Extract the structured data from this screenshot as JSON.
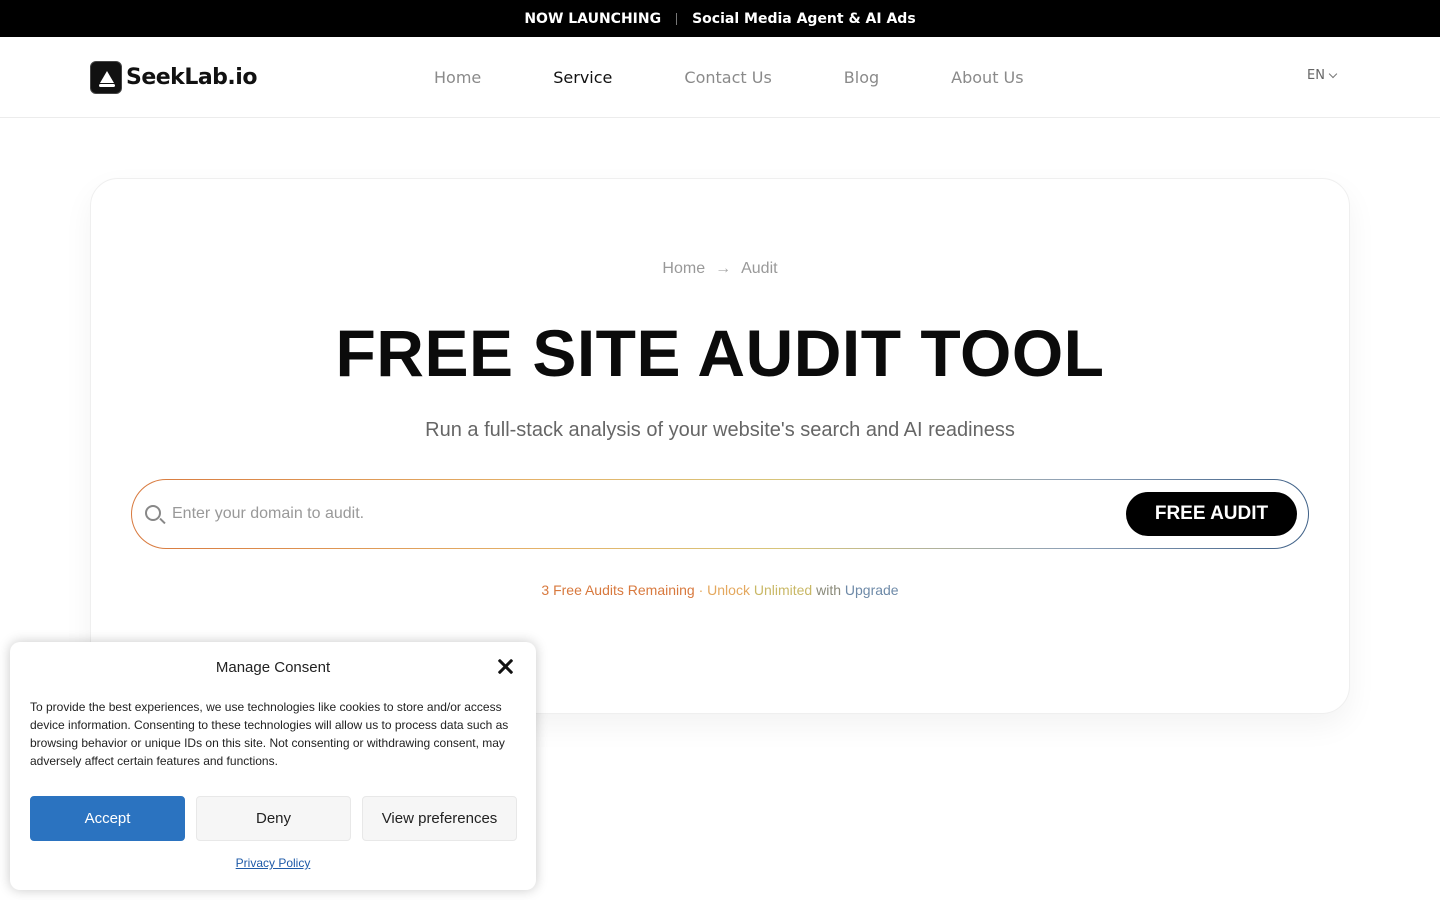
{
  "announcement": {
    "label": "NOW LAUNCHING",
    "message": "Social Media Agent & AI Ads"
  },
  "header": {
    "logo_text": "SeekLab.io",
    "nav": [
      {
        "label": "Home"
      },
      {
        "label": "Service"
      },
      {
        "label": "Contact Us"
      },
      {
        "label": "Blog"
      },
      {
        "label": "About Us"
      }
    ],
    "active_nav": "Service",
    "language": "EN"
  },
  "hero": {
    "breadcrumb": {
      "home": "Home",
      "arrow": "→",
      "current": "Audit"
    },
    "title": "FREE SITE AUDIT TOOL",
    "subtitle": "Run a full-stack analysis of your website's search and AI readiness",
    "search_placeholder": "Enter your domain to audit.",
    "search_value": "",
    "button_label": "FREE AUDIT",
    "remaining": {
      "part1": "3 Free Audits Remaining",
      "dot": " · ",
      "part2": "Unlock ",
      "part3": "Unlimited",
      "part4": " with ",
      "part5": "Upgrade"
    }
  },
  "consent": {
    "title": "Manage Consent",
    "text": "To provide the best experiences, we use technologies like cookies to store and/or access device information. Consenting to these technologies will allow us to process data such as browsing behavior or unique IDs on this site. Not consenting or withdrawing consent, may adversely affect certain features and functions.",
    "accept": "Accept",
    "deny": "Deny",
    "preferences": "View preferences",
    "privacy": "Privacy Policy"
  },
  "colors": {
    "accent_button": "#2b73c0",
    "gradient_start": "#d8793e",
    "gradient_end": "#3d5f86"
  }
}
